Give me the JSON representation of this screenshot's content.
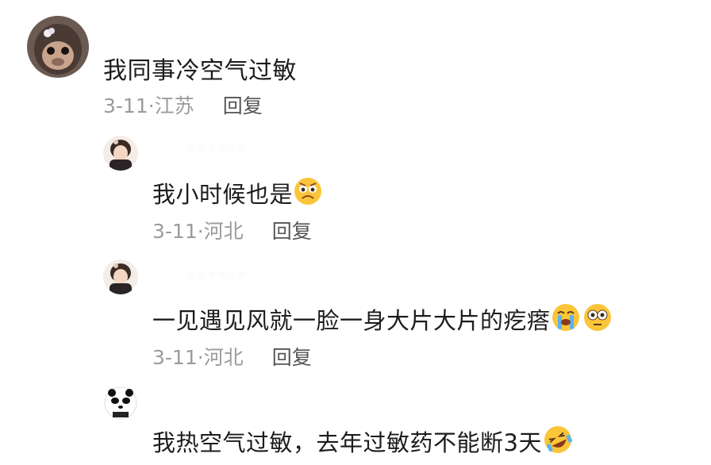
{
  "comments": [
    {
      "username": "· · · · · ·",
      "text": "我同事冷空气过敏",
      "date": "3-11·",
      "location": "江苏",
      "reply_label": "回复"
    },
    {
      "username": "· · · · · ·",
      "text": "我小时候也是",
      "date": "3-11·",
      "location": "河北",
      "reply_label": "回复"
    },
    {
      "username": "· · · · · ·",
      "text": "一见遇见风就一脸一身大片大片的疙瘩",
      "date": "3-11·",
      "location": "河北",
      "reply_label": "回复"
    },
    {
      "username": "· · · · · ·",
      "text": "我热空气过敏，去年过敏药不能断",
      "text_suffix": "3天",
      "date": "",
      "location": "",
      "reply_label": ""
    }
  ],
  "colors": {
    "text": "#1c1c1c",
    "meta": "#9b9b9b",
    "reply": "#555555"
  }
}
